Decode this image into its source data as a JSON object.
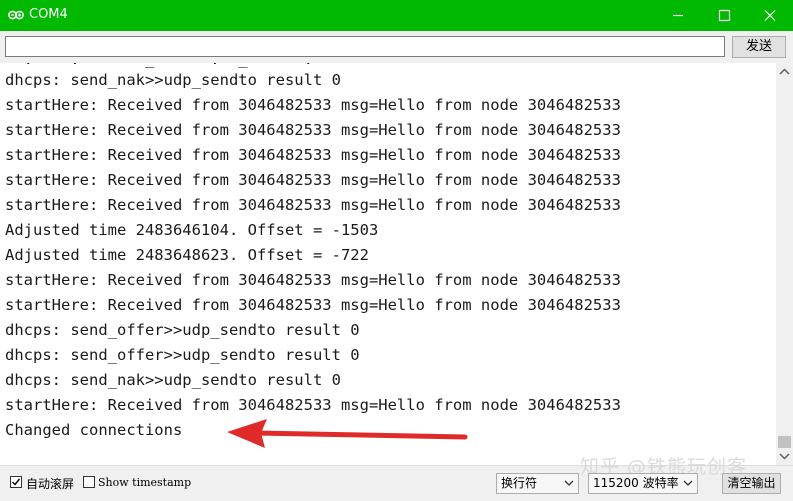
{
  "window": {
    "title": "COM4",
    "title_bar_color": "#00b900",
    "icons": [
      "arduino-icon",
      "minimize-icon",
      "maximize-icon",
      "close-icon"
    ]
  },
  "toolbar": {
    "input_value": "",
    "send_label": "发送"
  },
  "output": {
    "partial_line": "  .    .       _      .  _      .     ",
    "lines": [
      "dhcps: send_nak>>udp_sendto result 0",
      "startHere: Received from 3046482533 msg=Hello from node 3046482533",
      "startHere: Received from 3046482533 msg=Hello from node 3046482533",
      "startHere: Received from 3046482533 msg=Hello from node 3046482533",
      "startHere: Received from 3046482533 msg=Hello from node 3046482533",
      "startHere: Received from 3046482533 msg=Hello from node 3046482533",
      "Adjusted time 2483646104. Offset = -1503",
      "Adjusted time 2483648623. Offset = -722",
      "startHere: Received from 3046482533 msg=Hello from node 3046482533",
      "startHere: Received from 3046482533 msg=Hello from node 3046482533",
      "dhcps: send_offer>>udp_sendto result 0",
      "dhcps: send_offer>>udp_sendto result 0",
      "dhcps: send_nak>>udp_sendto result 0",
      "startHere: Received from 3046482533 msg=Hello from node 3046482533",
      "Changed connections"
    ],
    "annotation_color": "#e02a2a"
  },
  "statusbar": {
    "autoscroll_label": "自动滚屏",
    "autoscroll_checked": true,
    "timestamp_label": "Show timestamp",
    "timestamp_checked": false,
    "line_ending_value": "换行符",
    "baud_value": "115200 波特率",
    "clear_label": "清空输出"
  },
  "watermark": "知乎 @铁熊玩创客"
}
